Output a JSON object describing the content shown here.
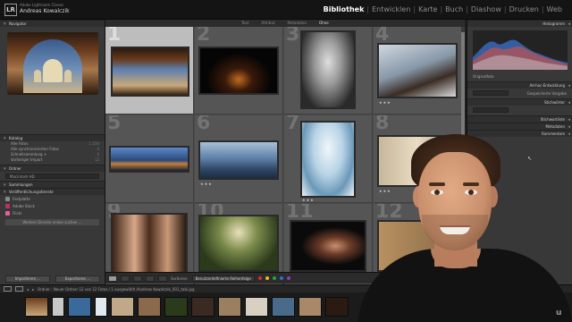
{
  "app": {
    "logo": "LR",
    "subtitle": "Adobe Lightroom Classic",
    "user": "Andreas Kowalczik"
  },
  "modules": [
    {
      "label": "Bibliothek",
      "active": true
    },
    {
      "label": "Entwicklen",
      "active": false
    },
    {
      "label": "Karte",
      "active": false
    },
    {
      "label": "Buch",
      "active": false
    },
    {
      "label": "Diashow",
      "active": false
    },
    {
      "label": "Drucken",
      "active": false
    },
    {
      "label": "Web",
      "active": false
    }
  ],
  "left_panel": {
    "navigator": "Navigator",
    "catalog": "Katalog",
    "catalog_rows": [
      {
        "label": "Alle Fotos",
        "count": "1.234"
      },
      {
        "label": "Alle synchronisierten Fotos",
        "count": "0"
      },
      {
        "label": "Schnellsammlung +",
        "count": "0"
      },
      {
        "label": "Vorheriger Import",
        "count": "12"
      }
    ],
    "folders": "Ordner",
    "folder_row": "Macintosh HD",
    "collections": "Sammlungen",
    "publish": "Veröffentlichungsdienste",
    "publish_rows": [
      {
        "label": "Festplatte",
        "color": "#8a8a8a"
      },
      {
        "label": "Adobe Stock",
        "color": "#c0305a"
      },
      {
        "label": "Flickr",
        "color": "#e060a0"
      }
    ],
    "find_more": "Weitere Dienste online suchen ...",
    "import_btn": "Importieren ...",
    "export_btn": "Exportieren ..."
  },
  "filter_bar": {
    "items": [
      {
        "label": "Text",
        "on": false
      },
      {
        "label": "Attribut",
        "on": false
      },
      {
        "label": "Metadaten",
        "on": false
      },
      {
        "label": "Ohne",
        "on": true
      }
    ]
  },
  "grid": {
    "cells": [
      {
        "num": "1",
        "selected": true,
        "stars": ""
      },
      {
        "num": "2",
        "selected": false,
        "stars": ""
      },
      {
        "num": "3",
        "selected": false,
        "stars": ""
      },
      {
        "num": "4",
        "selected": false,
        "stars": "★★★"
      },
      {
        "num": "5",
        "selected": false,
        "stars": ""
      },
      {
        "num": "6",
        "selected": false,
        "stars": "★★★"
      },
      {
        "num": "7",
        "selected": false,
        "stars": "★★★"
      },
      {
        "num": "8",
        "selected": false,
        "stars": "★★★"
      },
      {
        "num": "9",
        "selected": false,
        "stars": ""
      },
      {
        "num": "10",
        "selected": false,
        "stars": ""
      },
      {
        "num": "11",
        "selected": false,
        "stars": ""
      },
      {
        "num": "12",
        "selected": false,
        "stars": ""
      }
    ]
  },
  "toolbar": {
    "sort_label": "Sortieren:",
    "sort_value": "Benutzerdefinierte Reihenfolge",
    "colors": [
      "#d03030",
      "#e0c020",
      "#30a040",
      "#3070d0",
      "#9040b0"
    ]
  },
  "right_panel": {
    "histogram": "Histogramm",
    "original_photo": "Originalfoto",
    "quick_develop": "Ad-hoc-Entwicklung",
    "saved_preset": "Gespeicherte Vorgabe",
    "keywords": "Stichwörter",
    "keyword_list": "Stichwortliste",
    "metadata": "Metadaten",
    "comments": "Kommentare"
  },
  "film_header": {
    "info": "Ordner : Neuer Ordner   12 von 12 Fotos / 1 ausgewählt   /Andreas Kowalczik_001_tabi.jpg"
  },
  "watermark": "u"
}
